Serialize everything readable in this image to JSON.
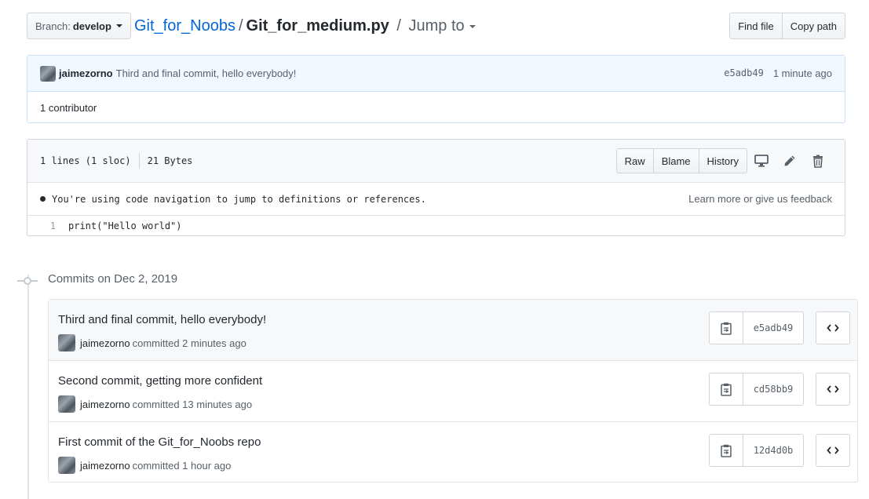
{
  "topbar": {
    "branch_label": "Branch:",
    "branch_value": "develop",
    "repo": "Git_for_Noobs",
    "separator": "/",
    "file": "Git_for_medium.py",
    "jump_to": "Jump to",
    "find_file": "Find file",
    "copy_path": "Copy path"
  },
  "tease": {
    "author": "jaimezorno",
    "message": "Third and final commit, hello everybody!",
    "sha": "e5adb49",
    "time": "1 minute ago",
    "contributors": "1 contributor"
  },
  "file": {
    "lines": "1 lines (1 sloc)",
    "size": "21 Bytes",
    "raw": "Raw",
    "blame": "Blame",
    "history": "History",
    "nav_note": "You're using code navigation to jump to definitions or references.",
    "learn_more": "Learn more or give us feedback",
    "code": [
      {
        "ln": "1",
        "text": "print(\"Hello world\")"
      }
    ]
  },
  "commits": {
    "heading": "Commits on Dec 2, 2019",
    "items": [
      {
        "title": "Third and final commit, hello everybody!",
        "author": "jaimezorno",
        "time": "committed 2 minutes ago",
        "sha": "e5adb49"
      },
      {
        "title": "Second commit, getting more confident",
        "author": "jaimezorno",
        "time": "committed 13 minutes ago",
        "sha": "cd58bb9"
      },
      {
        "title": "First commit of the Git_for_Noobs repo",
        "author": "jaimezorno",
        "time": "committed 1 hour ago",
        "sha": "12d4d0b"
      }
    ]
  },
  "icons": {
    "display": "desktop-icon",
    "edit": "pencil-icon",
    "delete": "trash-icon",
    "copy": "clipboard-icon",
    "browse": "code-icon"
  }
}
